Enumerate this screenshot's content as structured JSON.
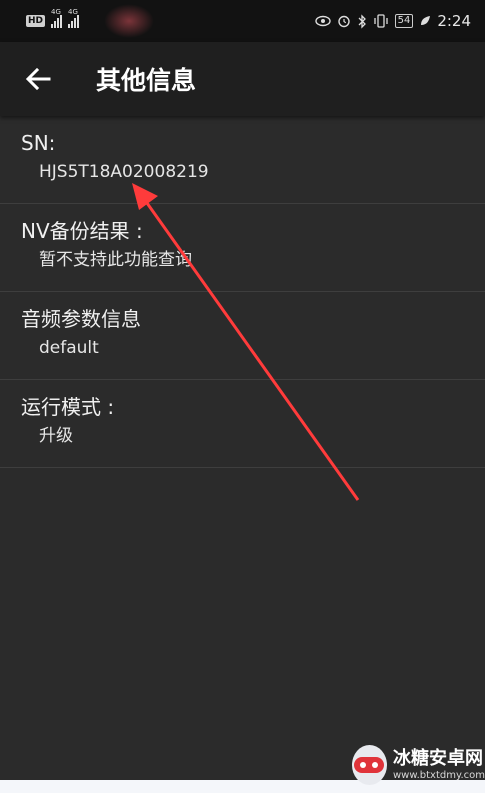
{
  "status_bar": {
    "hd": "HD",
    "signal_1_label": "4G",
    "signal_2_label": "4G",
    "battery": "54",
    "time": "2:24"
  },
  "app_bar": {
    "title": "其他信息",
    "back_icon": "arrow-left-icon"
  },
  "items": [
    {
      "title": "SN:",
      "value": "HJS5T18A02008219"
    },
    {
      "title": "NV备份结果 :",
      "value": "暂不支持此功能查询"
    },
    {
      "title": "音频参数信息",
      "value": "default"
    },
    {
      "title": "运行模式 :",
      "value": "升级"
    }
  ],
  "annotation": {
    "color": "#ff3b3b"
  },
  "watermark": {
    "title": "冰糖安卓网",
    "url": "www.btxtdmy.com"
  }
}
